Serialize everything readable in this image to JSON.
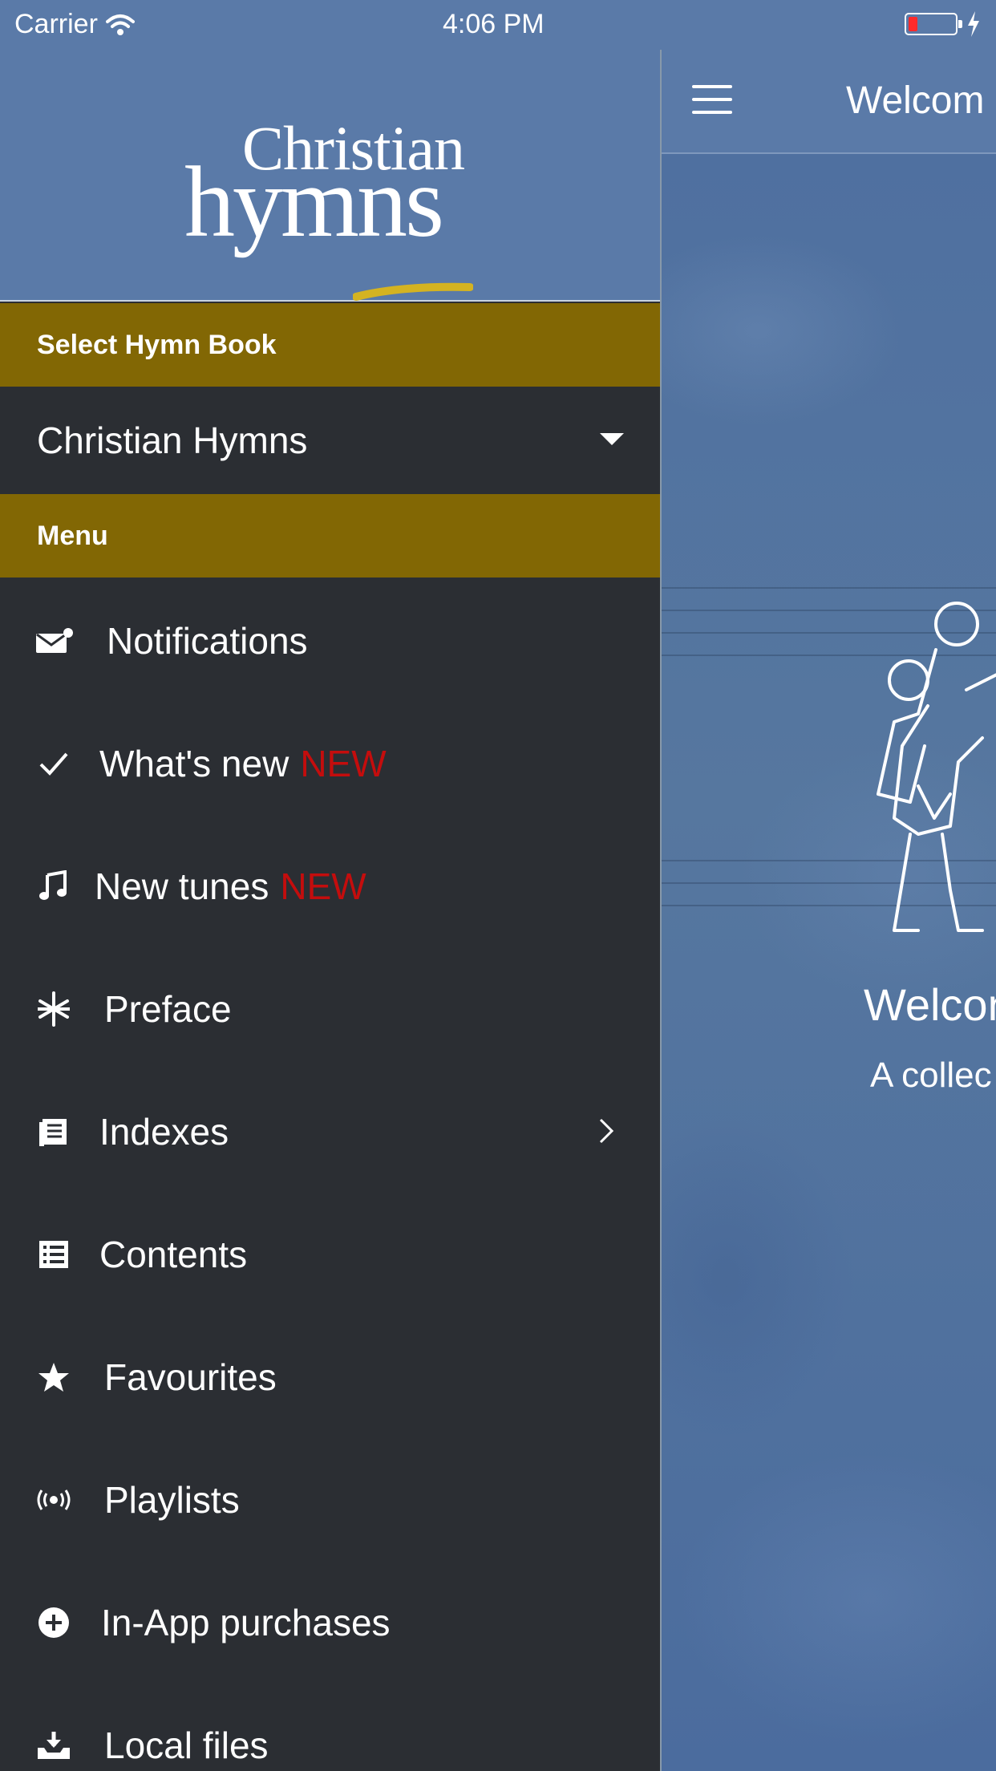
{
  "status_bar": {
    "carrier": "Carrier",
    "time": "4:06 PM",
    "battery_level": 0.2
  },
  "main": {
    "title": "Welcom",
    "welcome": "Welcon",
    "subtitle": "A collec"
  },
  "drawer": {
    "logo_top": "Christian",
    "logo_bottom": "hymns",
    "select_hymn_book_label": "Select Hymn Book",
    "selected_book": "Christian Hymns",
    "menu_section_label": "Menu",
    "items": [
      {
        "label": "Notifications",
        "icon": "envelope-icon"
      },
      {
        "label": "What's new",
        "badge": "NEW",
        "icon": "checkmark-icon"
      },
      {
        "label": "New tunes",
        "badge": "NEW",
        "icon": "music-note-icon"
      },
      {
        "label": "Preface",
        "icon": "asterisk-icon"
      },
      {
        "label": "Indexes",
        "icon": "book-icon",
        "has_submenu": true
      },
      {
        "label": "Contents",
        "icon": "list-icon"
      },
      {
        "label": "Favourites",
        "icon": "star-icon"
      },
      {
        "label": "Playlists",
        "icon": "broadcast-icon"
      },
      {
        "label": "In-App purchases",
        "icon": "plus-circle-icon"
      },
      {
        "label": "Local files",
        "icon": "download-tray-icon"
      }
    ]
  },
  "colors": {
    "header_blue": "#5a7aa8",
    "gold_bar": "#826704",
    "drawer_bg": "#2b2e33",
    "new_badge": "#c40d0d"
  }
}
